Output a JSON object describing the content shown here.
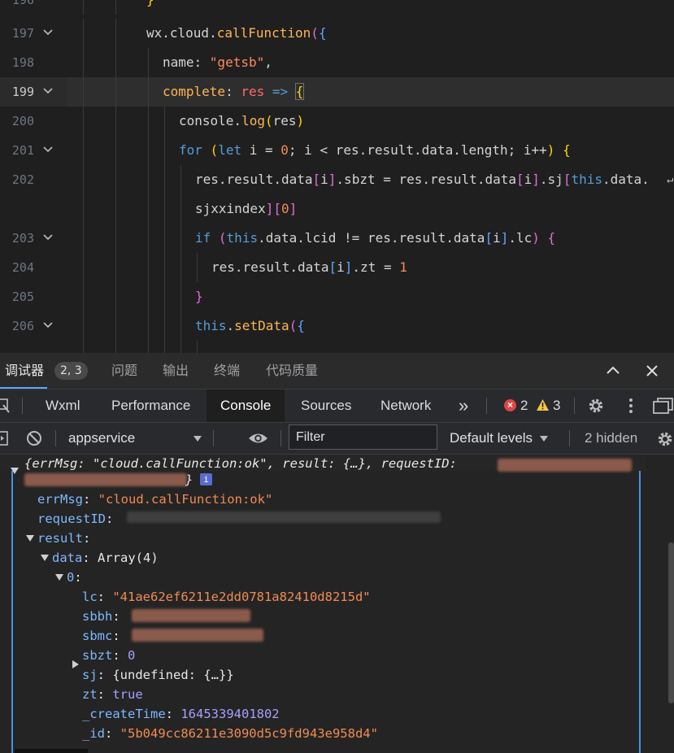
{
  "editor": {
    "lines": [
      {
        "num": "196",
        "text": "}"
      },
      {
        "num": "197",
        "text": "wx.cloud.callFunction({"
      },
      {
        "num": "198",
        "text": "name: \"getsb\","
      },
      {
        "num": "199",
        "text": "complete: res => {"
      },
      {
        "num": "200",
        "text": "console.log(res)"
      },
      {
        "num": "201",
        "text": "for (let i = 0; i < res.result.data.length; i++) {"
      },
      {
        "num": "202",
        "text": "res.result.data[i].sbzt = res.result.data[i].sj[this.data."
      },
      {
        "num": "",
        "text": "sjxxindex][0]"
      },
      {
        "num": "203",
        "text": "if (this.data.lcid != res.result.data[i].lc) {"
      },
      {
        "num": "204",
        "text": "res.result.data[i].zt = 1"
      },
      {
        "num": "205",
        "text": "}"
      },
      {
        "num": "206",
        "text": "this.setData({"
      }
    ]
  },
  "devtools": {
    "tabs": {
      "debugger": "调试器",
      "badge": "2, 3",
      "problems": "问题",
      "output": "输出",
      "terminal": "终端",
      "quality": "代码质量"
    },
    "panel_tabs": [
      "Wxml",
      "Performance",
      "Console",
      "Sources",
      "Network"
    ],
    "more": "»",
    "errors": "2",
    "warnings": "3",
    "toolbar": {
      "context": "appservice",
      "filter_placeholder": "Filter",
      "levels": "Default levels",
      "hidden": "2 hidden"
    },
    "console": {
      "summary": "{errMsg: \"cloud.callFunction:ok\", result: {…}, requestID:",
      "summary_end": "}",
      "info_badge": "i",
      "errMsg_key": "errMsg",
      "errMsg_val": "\"cloud.callFunction:ok\"",
      "requestID_key": "requestID",
      "result_key": "result",
      "data_key": "data",
      "data_val": "Array(4)",
      "index_key": "0",
      "lc_key": "lc",
      "lc_val": "\"41ae62ef6211e2dd0781a82410d8215d\"",
      "sbbh_key": "sbbh",
      "sbmc_key": "sbmc",
      "sbzt_key": "sbzt",
      "sbzt_val": "0",
      "sj_key": "sj",
      "sj_val": "{undefined: {…}}",
      "zt_key": "zt",
      "zt_val": "true",
      "createTime_key": "_createTime",
      "createTime_val": "1645339401802",
      "id_key": "_id",
      "id_val": "\"5b049cc86211e3090d5c9fd943e958d4\""
    }
  },
  "colors": {
    "accent": "#5aa9ff",
    "error": "#e04646",
    "warning": "#f5c542"
  }
}
